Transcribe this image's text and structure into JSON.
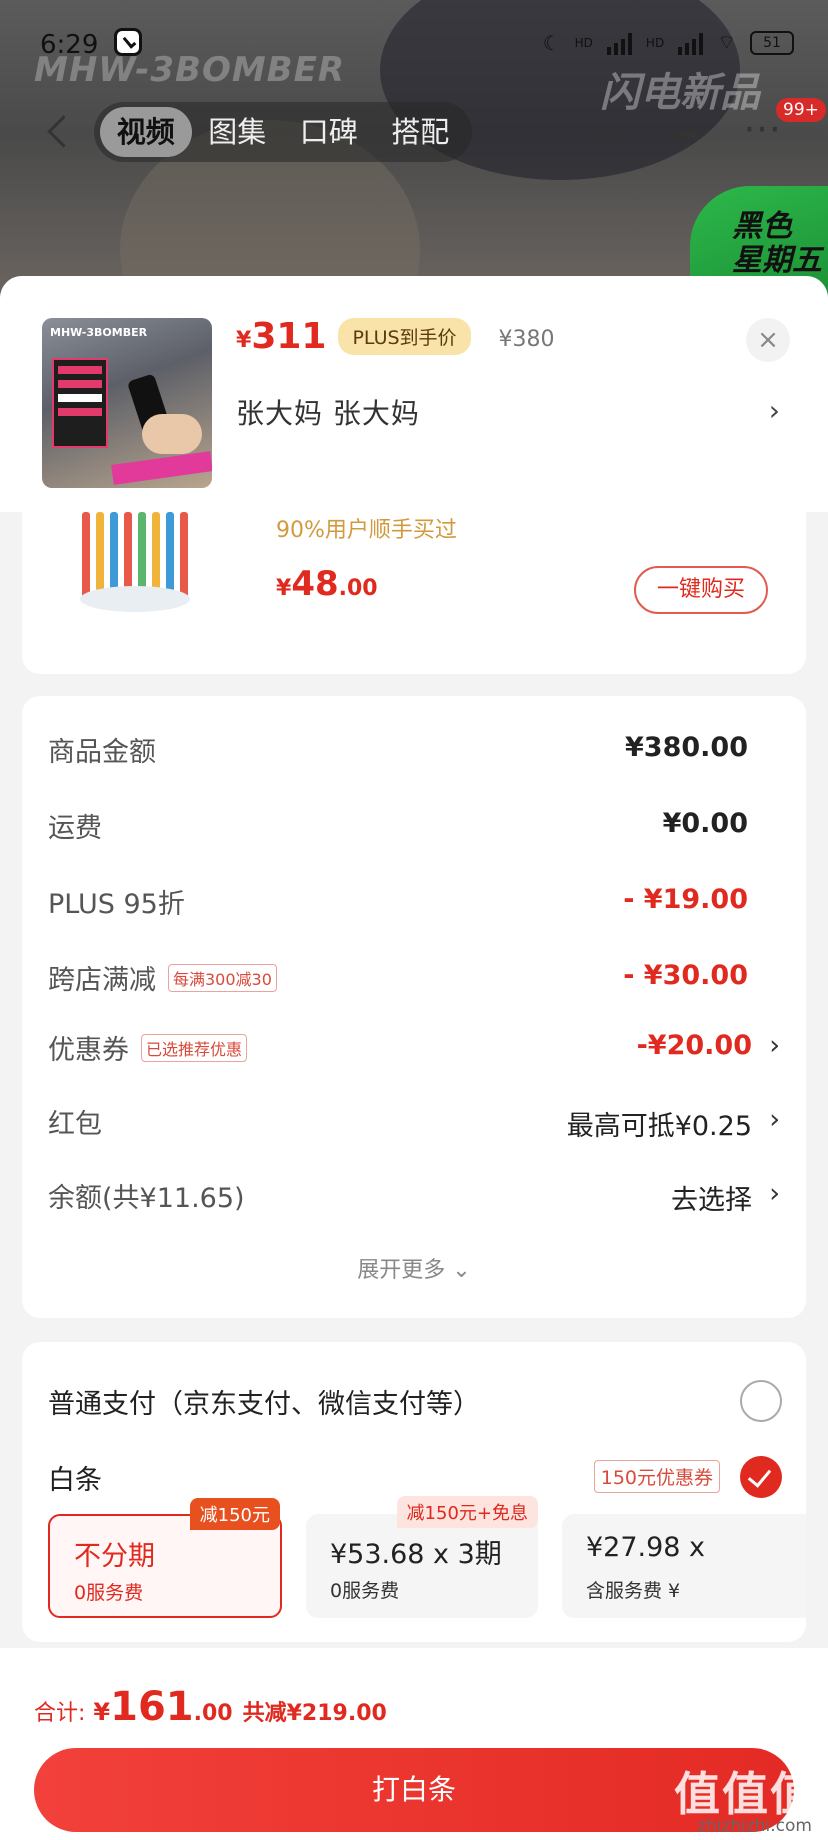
{
  "status_bar": {
    "time": "6:29",
    "net1": "HD",
    "net2": "HD",
    "battery": "51"
  },
  "background": {
    "brand_logo": "MHW-3BOMBER",
    "promo_text": "闪电新品",
    "corner_promo_line1": "黑色",
    "corner_promo_line2": "星期五"
  },
  "nav": {
    "tabs": [
      {
        "label": "视频",
        "active": true
      },
      {
        "label": "图集",
        "active": false
      },
      {
        "label": "口碑",
        "active": false
      },
      {
        "label": "搭配",
        "active": false
      }
    ],
    "more_badge": "99+"
  },
  "header": {
    "price_currency": "¥",
    "price": "311",
    "plus_tag": "PLUS到手价",
    "original_price": "¥380",
    "address": "张大妈  张大妈",
    "arrow": "›",
    "close": "×"
  },
  "addon": {
    "subtitle": "90%用户顺手买过",
    "price_currency": "¥",
    "price_int": "48",
    "price_dec": ".00",
    "buy_label": "一键购买"
  },
  "breakdown": {
    "rows": [
      {
        "label": "商品金额",
        "value": "¥380.00",
        "tag": ""
      },
      {
        "label": "运费",
        "value": "¥0.00",
        "tag": ""
      },
      {
        "label": "PLUS 95折",
        "value": "- ¥19.00",
        "tag": ""
      },
      {
        "label": "跨店满减",
        "value": "- ¥30.00",
        "tag": "每满300减30"
      },
      {
        "label": "优惠券",
        "value": "-¥20.00",
        "tag": "已选推荐优惠"
      },
      {
        "label": "红包",
        "value": "最高可抵¥0.25",
        "tag": ""
      },
      {
        "label": "余额(共¥11.65)",
        "value": "去选择",
        "tag": ""
      }
    ],
    "expand_label": "展开更多 ⌄"
  },
  "payment": {
    "normal_label": "普通支付（京东支付、微信支付等）",
    "baitiao_label": "白条",
    "baitiao_coupon": "150元优惠券",
    "plans": [
      {
        "main": "不分期",
        "sub": "0服务费",
        "badge": "减150元",
        "selected": true
      },
      {
        "main": "¥53.68 x 3期",
        "sub": "0服务费",
        "badge": "减150元+免息",
        "selected": false
      },
      {
        "main": "¥27.98 x",
        "sub": "含服务费 ¥",
        "badge": "",
        "selected": false
      }
    ]
  },
  "bottom": {
    "total_label": "合计:",
    "total_currency": "¥",
    "total_int": "161",
    "total_dec": ".00",
    "saved": "共减¥219.00",
    "cta": "打白条",
    "watermark": "值值值",
    "watermark_url": "zhizhizhi.com"
  },
  "colors": {
    "accent": "#e0291f",
    "plus_tag_bg": "#f9e3a8",
    "addon_subtitle": "#d29a3e"
  }
}
